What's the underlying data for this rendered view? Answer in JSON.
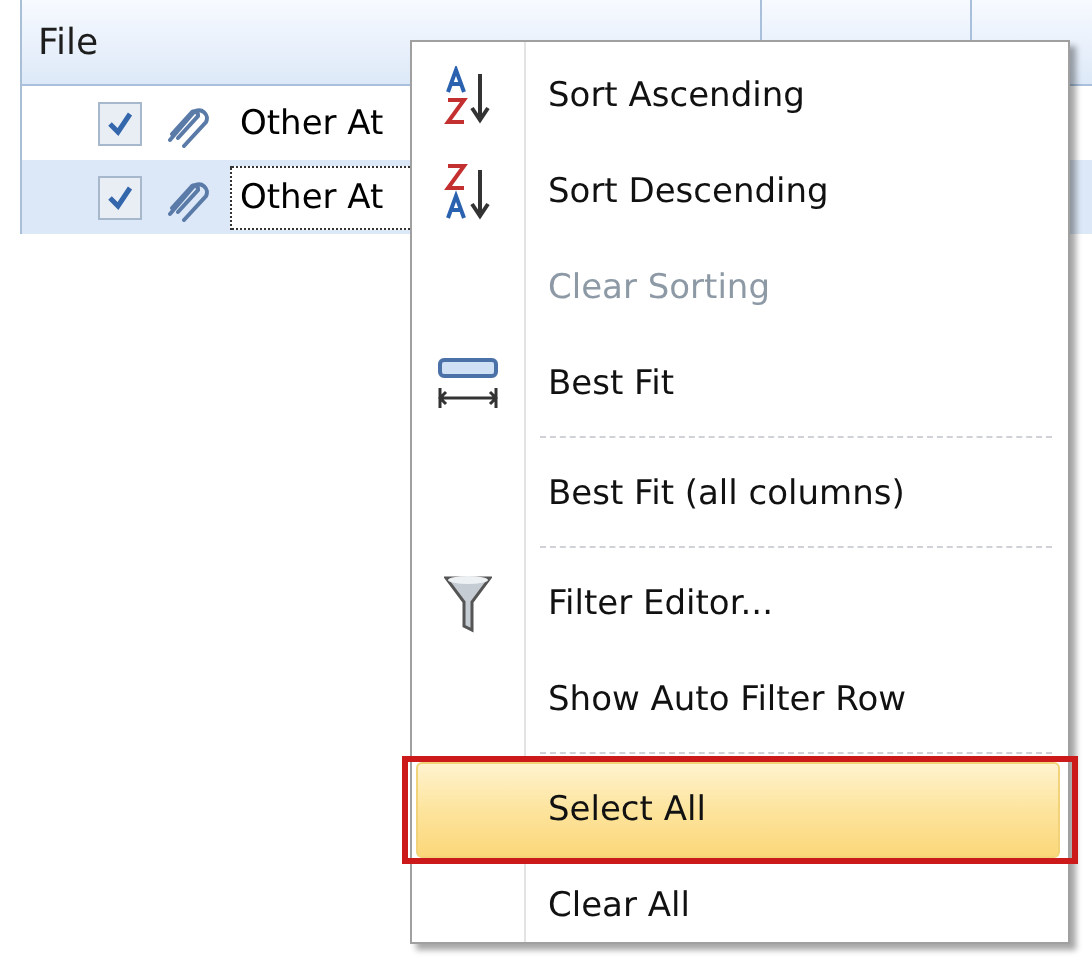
{
  "grid": {
    "columns": [
      {
        "header": "File"
      },
      {},
      {}
    ],
    "rows": [
      {
        "checked": true,
        "file": "Other At",
        "selected": false,
        "focused": false
      },
      {
        "checked": true,
        "file": "Other At",
        "selected": true,
        "focused": true
      }
    ]
  },
  "context_menu": {
    "items": [
      {
        "kind": "ascending",
        "label": "Sort Ascending",
        "disabled": false,
        "highlighted": false,
        "annotated": false
      },
      {
        "kind": "descending",
        "label": "Sort Descending",
        "disabled": false,
        "highlighted": false,
        "annotated": false
      },
      {
        "kind": "item",
        "label": "Clear Sorting",
        "disabled": true,
        "highlighted": false,
        "annotated": false
      },
      {
        "kind": "bestfit",
        "label": "Best Fit",
        "disabled": false,
        "highlighted": false,
        "annotated": false
      },
      {
        "kind": "separator"
      },
      {
        "kind": "item",
        "label": "Best Fit (all columns)",
        "disabled": false,
        "highlighted": false,
        "annotated": false
      },
      {
        "kind": "separator"
      },
      {
        "kind": "filter",
        "label": "Filter Editor...",
        "disabled": false,
        "highlighted": false,
        "annotated": false
      },
      {
        "kind": "item",
        "label": "Show Auto Filter Row",
        "disabled": false,
        "highlighted": false,
        "annotated": false
      },
      {
        "kind": "separator"
      },
      {
        "kind": "item",
        "label": "Select All",
        "disabled": false,
        "highlighted": true,
        "annotated": true
      },
      {
        "kind": "item",
        "label": "Clear All",
        "disabled": false,
        "highlighted": false,
        "annotated": false
      }
    ]
  }
}
